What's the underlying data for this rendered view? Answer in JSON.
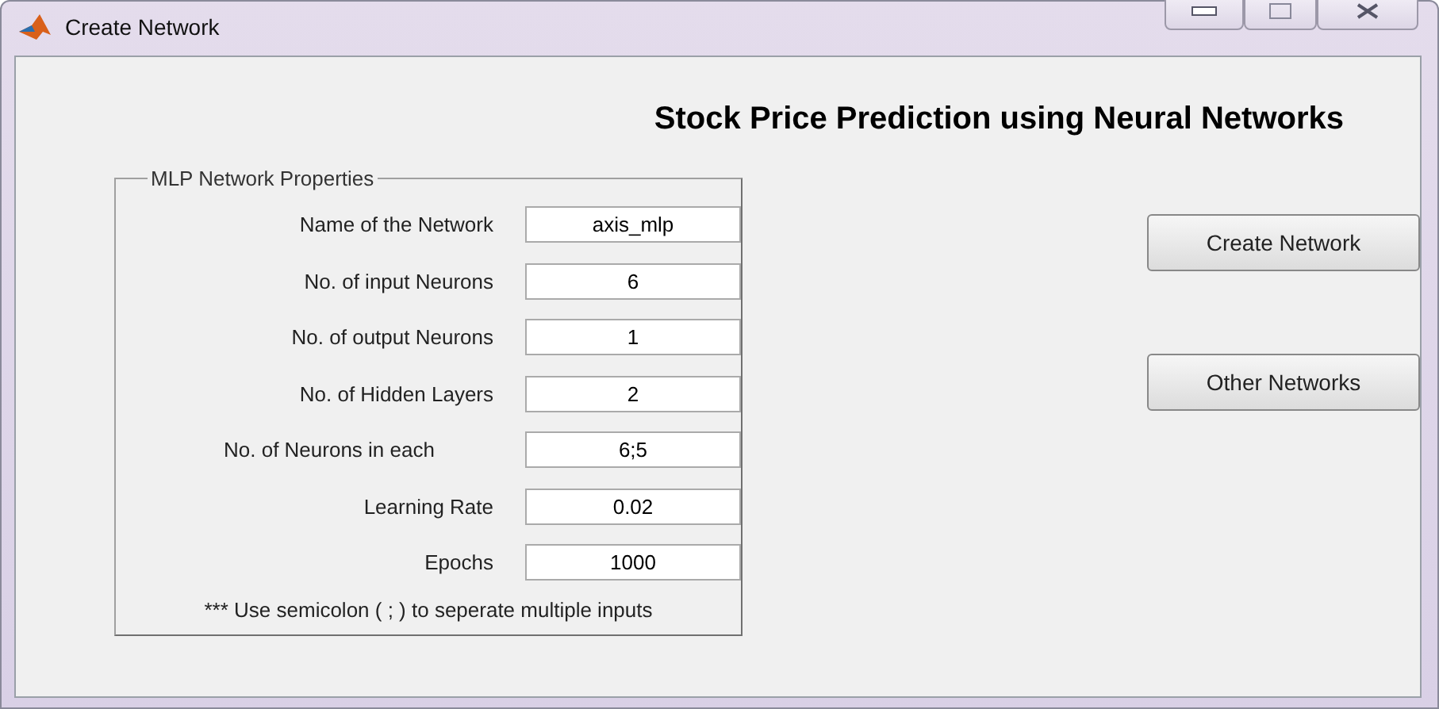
{
  "window": {
    "title": "Create Network"
  },
  "heading": "Stock Price Prediction using Neural Networks",
  "group": {
    "title": "MLP Network Properties",
    "fields": [
      {
        "label": "Name of the Network",
        "value": "axis_mlp"
      },
      {
        "label": "No. of input Neurons",
        "value": "6"
      },
      {
        "label": "No. of output Neurons",
        "value": "1"
      },
      {
        "label": "No. of Hidden Layers",
        "value": "2"
      },
      {
        "label": "No. of Neurons in each",
        "value": "6;5"
      },
      {
        "label": "Learning Rate",
        "value": "0.02"
      },
      {
        "label": "Epochs",
        "value": "1000"
      }
    ],
    "note": "*** Use semicolon ( ; ) to seperate multiple inputs"
  },
  "buttons": [
    "Create Network",
    "Other Networks"
  ]
}
